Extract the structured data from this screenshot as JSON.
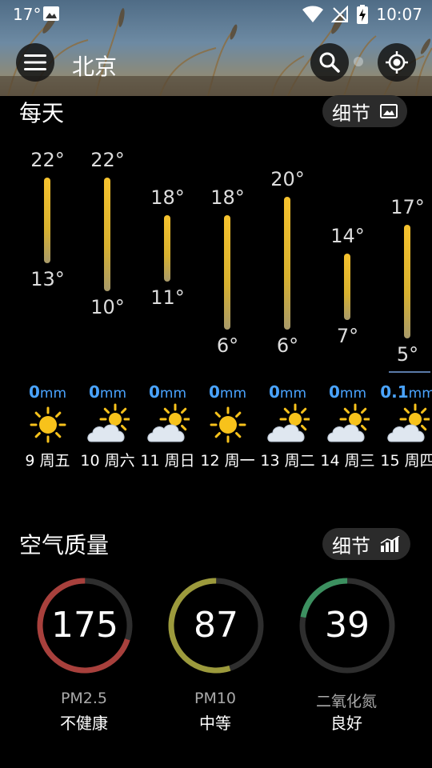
{
  "status_bar": {
    "temperature": "17°",
    "time": "10:07"
  },
  "app_bar": {
    "city": "北京"
  },
  "daily": {
    "title": "每天",
    "detail_label": "细节",
    "days": [
      {
        "high": "22°",
        "low": "13°",
        "rain_value": "0",
        "rain_unit": "mm",
        "icon": "sunny-icon",
        "label": "9 周五",
        "high_value": 22,
        "low_value": 13
      },
      {
        "high": "22°",
        "low": "10°",
        "rain_value": "0",
        "rain_unit": "mm",
        "icon": "partly-cloudy-icon",
        "label": "10 周六",
        "high_value": 22,
        "low_value": 10
      },
      {
        "high": "18°",
        "low": "11°",
        "rain_value": "0",
        "rain_unit": "mm",
        "icon": "partly-cloudy-icon",
        "label": "11 周日",
        "high_value": 18,
        "low_value": 11
      },
      {
        "high": "18°",
        "low": "6°",
        "rain_value": "0",
        "rain_unit": "mm",
        "icon": "sunny-icon",
        "label": "12 周一",
        "high_value": 18,
        "low_value": 6
      },
      {
        "high": "20°",
        "low": "6°",
        "rain_value": "0",
        "rain_unit": "mm",
        "icon": "partly-cloudy-icon",
        "label": "13 周二",
        "high_value": 20,
        "low_value": 6
      },
      {
        "high": "14°",
        "low": "7°",
        "rain_value": "0",
        "rain_unit": "mm",
        "icon": "partly-cloudy-icon",
        "label": "14 周三",
        "high_value": 14,
        "low_value": 7
      },
      {
        "high": "17°",
        "low": "5°",
        "rain_value": "0.1",
        "rain_unit": "mm",
        "icon": "partly-cloudy-icon",
        "label": "15 周四",
        "high_value": 17,
        "low_value": 5
      }
    ]
  },
  "air_quality": {
    "title": "空气质量",
    "detail_label": "细节",
    "gauges": [
      {
        "value": "175",
        "name": "PM2.5",
        "level": "不健康",
        "fraction": 0.7,
        "color": "#a8403c"
      },
      {
        "value": "87",
        "name": "PM10",
        "level": "中等",
        "fraction": 0.55,
        "color": "#9c9a3c"
      },
      {
        "value": "39",
        "name": "二氧化氮",
        "level": "良好",
        "fraction": 0.22,
        "color": "#3c9060"
      }
    ]
  },
  "colors": {
    "bar_top": "#f6c22e",
    "rain": "#4aa4ff",
    "sun": "#f7c21b"
  }
}
